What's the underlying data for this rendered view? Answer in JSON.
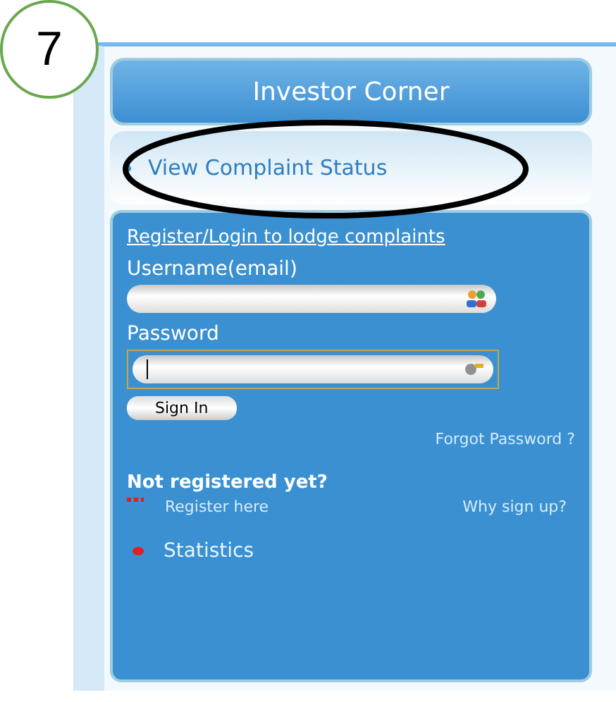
{
  "annotation": {
    "step": "7"
  },
  "panel": {
    "title": "Investor Corner",
    "link": "View Complaint Status"
  },
  "login": {
    "heading": "Register/Login to lodge complaints",
    "username_label": "Username(email)",
    "password_label": "Password",
    "password_focused": true,
    "sign_in": "Sign In",
    "forgot": "Forgot Password ?"
  },
  "register": {
    "heading": "Not registered yet?",
    "register_link": "Register here",
    "why_link": "Why sign up?"
  },
  "statistics": "Statistics"
}
